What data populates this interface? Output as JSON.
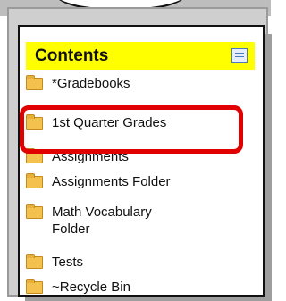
{
  "contents": {
    "title": "Contents",
    "items": [
      {
        "label": "*Gradebooks"
      },
      {
        "label": "1st Quarter Grades"
      },
      {
        "label": "Assignments"
      },
      {
        "label": "Assignments Folder"
      },
      {
        "label": "Math Vocabulary Folder"
      },
      {
        "label": "Tests"
      },
      {
        "label": "~Recycle Bin"
      }
    ]
  },
  "colors": {
    "header": "#ffff00",
    "highlight": "#e00000",
    "folder": "#f2c14e"
  }
}
